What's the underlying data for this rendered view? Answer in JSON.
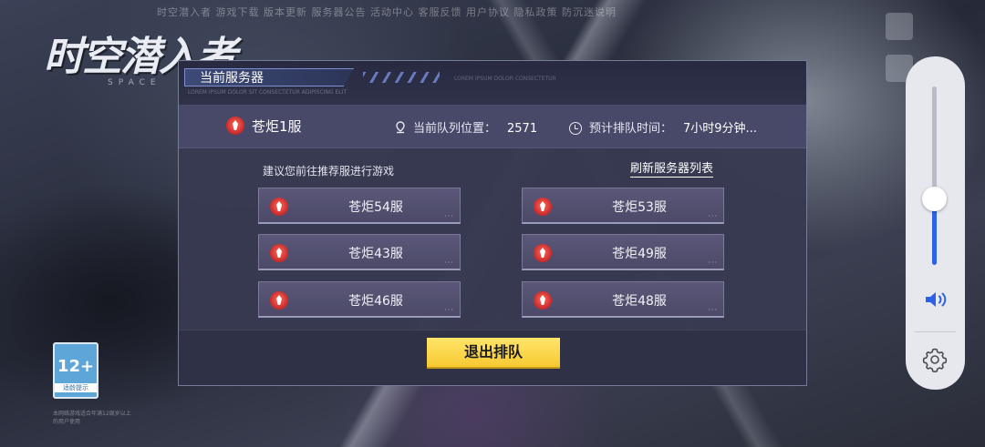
{
  "background": {
    "ticker": "时空潜入者  游戏下载  版本更新  服务器公告  活动中心  客服反馈  用户协议  隐私政策  防沉迷说明",
    "logo": "时空潜入者",
    "logo_sub": "SPACE",
    "age_rating": "12+",
    "age_rating_caption": "适龄提示",
    "legal_text": "本网络游戏适合年满12周岁以上的用户使用"
  },
  "dialog": {
    "title": "当前服务器",
    "fine_text": "LOREM IPSUM DOLOR SIT CONSECTETUR ADIPISCING ELIT",
    "fine_text_2": "LOREM IPSUM DOLOR CONSECTETUR",
    "current_server": "苍炬1服",
    "queue_position_label": "当前队列位置：",
    "queue_position_value": "2571",
    "estimated_wait_label": "预计排队时间：",
    "estimated_wait_value": "7小时9分钟...",
    "recommend_text": "建议您前往推荐服进行游戏",
    "refresh_label": "刷新服务器列表",
    "servers": [
      {
        "label": "苍炬54服"
      },
      {
        "label": "苍炬53服"
      },
      {
        "label": "苍炬43服"
      },
      {
        "label": "苍炬49服"
      },
      {
        "label": "苍炬46服"
      },
      {
        "label": "苍炬48服"
      }
    ],
    "exit_label": "退出排队"
  },
  "volume_panel": {
    "level": 0.37,
    "accent_color": "#2e62e6",
    "icons": [
      "speaker-icon",
      "gear-icon"
    ]
  },
  "colors": {
    "exit_button": "#f7c932",
    "server_icon": "#d4302c"
  }
}
